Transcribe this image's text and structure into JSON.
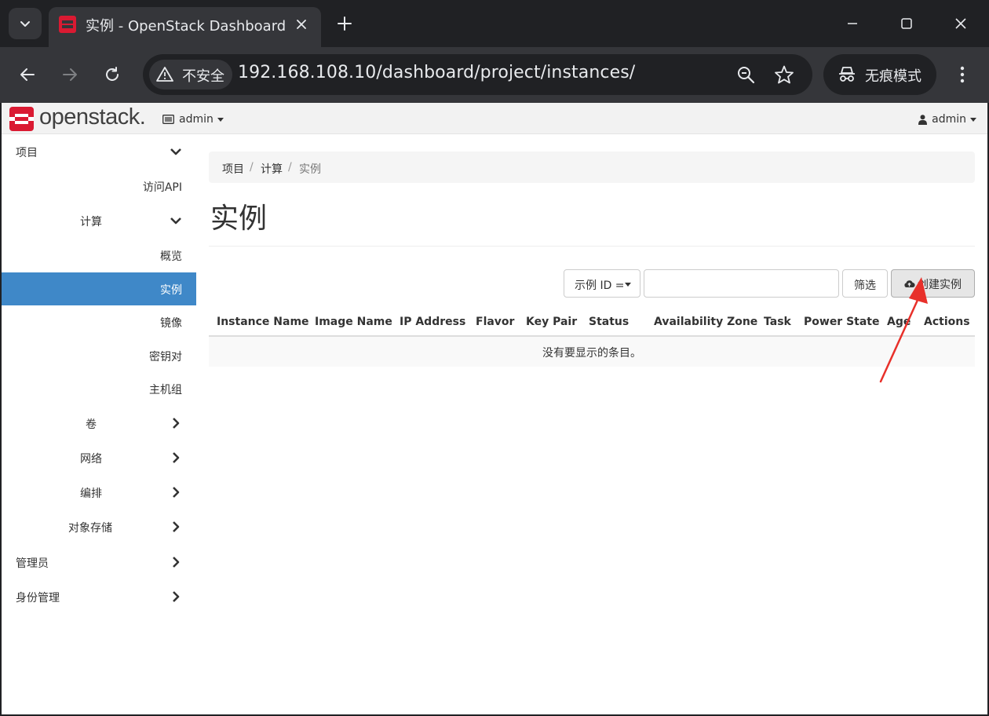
{
  "browser": {
    "tab_title": "实例 - OpenStack Dashboard",
    "security_label": "不安全",
    "url": "192.168.108.10/dashboard/project/instances/",
    "incognito_label": "无痕模式"
  },
  "navbar": {
    "logo_text": "openstack.",
    "project_menu": "admin",
    "user_menu": "admin"
  },
  "sidebar": {
    "items": [
      {
        "label": "项目",
        "chevron": "chevron-down-icon"
      },
      {
        "label": "访问API"
      },
      {
        "label": "计算",
        "chevron": "chevron-down-icon"
      },
      {
        "label": "概览"
      },
      {
        "label": "实例",
        "active": true
      },
      {
        "label": "镜像"
      },
      {
        "label": "密钥对"
      },
      {
        "label": "主机组"
      },
      {
        "label": "卷",
        "chevron": "chevron-right-icon"
      },
      {
        "label": "网络",
        "chevron": "chevron-right-icon"
      },
      {
        "label": "编排",
        "chevron": "chevron-right-icon"
      },
      {
        "label": "对象存储",
        "chevron": "chevron-right-icon"
      },
      {
        "label": "管理员",
        "chevron": "chevron-right-icon"
      },
      {
        "label": "身份管理",
        "chevron": "chevron-right-icon"
      }
    ]
  },
  "breadcrumb": [
    "项目",
    "计算",
    "实例"
  ],
  "page_title": "实例",
  "filter": {
    "select_label": "示例 ID =",
    "input_value": "",
    "filter_button": "筛选",
    "create_button": "创建实例"
  },
  "table": {
    "columns": [
      "Instance Name",
      "Image Name",
      "IP Address",
      "Flavor",
      "Key Pair",
      "Status",
      "Availability Zone",
      "Task",
      "Power State",
      "Age",
      "Actions"
    ],
    "empty_message": "没有要显示的条目。"
  },
  "colors": {
    "active_sidebar": "#3f88c8",
    "openstack_red": "#da1a32",
    "annotation_arrow": "#e8302a"
  }
}
